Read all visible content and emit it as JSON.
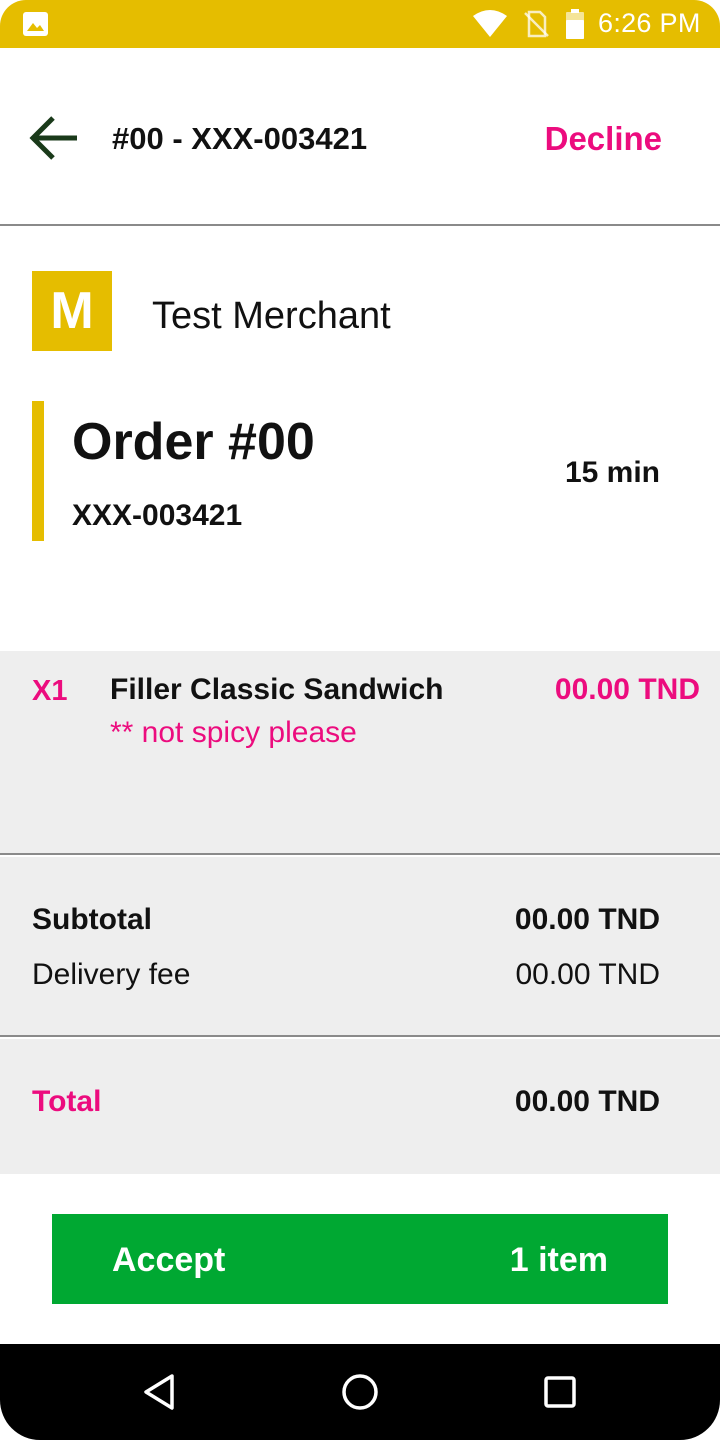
{
  "colors": {
    "accent_yellow": "#E5BD00",
    "accent_pink": "#EC0C7E",
    "accept_green": "#00A832",
    "section_gray": "#EEEEEE"
  },
  "status_bar": {
    "time": "6:26 PM",
    "icons": [
      "gallery-icon",
      "wifi-icon",
      "no-sim-icon",
      "battery-icon"
    ]
  },
  "header": {
    "back_icon": "arrow-left-icon",
    "title": "#00 - XXX-003421",
    "decline_label": "Decline"
  },
  "merchant": {
    "logo_letter": "M",
    "name": "Test Merchant"
  },
  "order": {
    "title": "Order #00",
    "code": "XXX-003421",
    "eta": "15 min"
  },
  "items": [
    {
      "qty": "X1",
      "name": "Filler Classic Sandwich",
      "price": "00.00 TND",
      "note": "** not spicy please"
    }
  ],
  "summary": {
    "subtotal_label": "Subtotal",
    "subtotal_value": "00.00 TND",
    "delivery_fee_label": "Delivery fee",
    "delivery_fee_value": "00.00 TND",
    "total_label": "Total",
    "total_value": "00.00 TND"
  },
  "accept": {
    "label": "Accept",
    "count": "1 item"
  },
  "nav_bar": {
    "icons": [
      "nav-back-icon",
      "nav-home-icon",
      "nav-recents-icon"
    ]
  }
}
